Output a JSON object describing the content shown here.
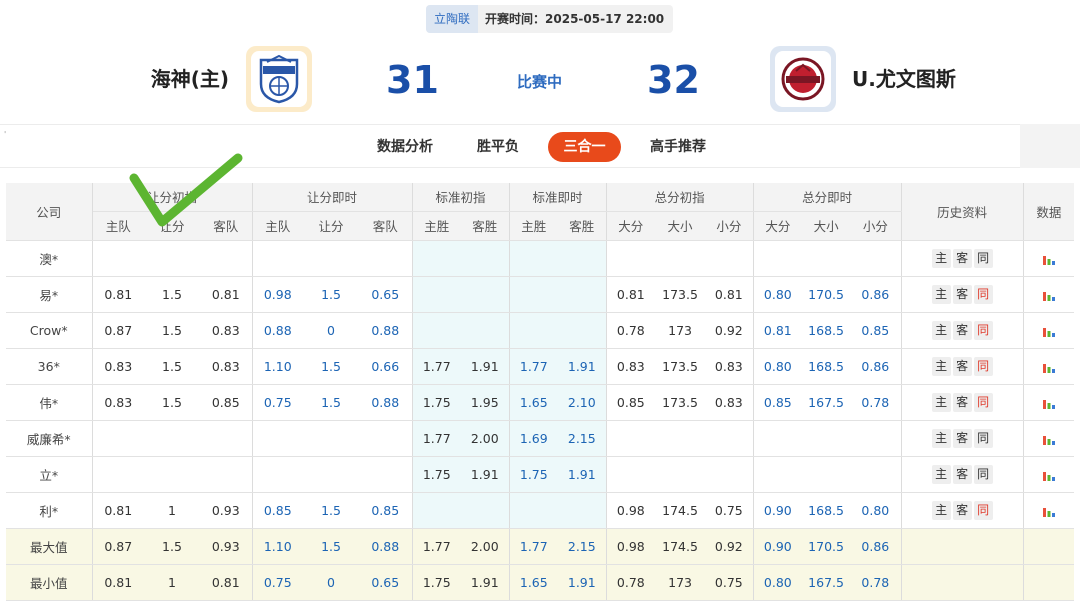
{
  "header": {
    "league": "立陶联",
    "kickoff": "开赛时间：2025-05-17 22:00",
    "home": {
      "name": "海神(主)",
      "score": "31"
    },
    "away": {
      "name": "U.尤文图斯",
      "score": "32"
    },
    "status": "比赛中"
  },
  "tabs": [
    {
      "label": "数据分析",
      "active": false
    },
    {
      "label": "胜平负",
      "active": false
    },
    {
      "label": "三合一",
      "active": true
    },
    {
      "label": "高手推荐",
      "active": false
    }
  ],
  "table": {
    "company_header": "公司",
    "groups": [
      "让分初指",
      "让分即时",
      "标准初指",
      "标准即时",
      "总分初指",
      "总分即时"
    ],
    "history_header": "历史资料",
    "data_header": "数据",
    "sub": {
      "handicap": [
        "主队",
        "让分",
        "客队"
      ],
      "standard": [
        "主胜",
        "客胜"
      ],
      "total": [
        "大分",
        "大小",
        "小分"
      ]
    },
    "history_buttons": [
      "主",
      "客",
      "同"
    ],
    "rows": [
      {
        "company": "澳*",
        "c": [
          "",
          "",
          "",
          "",
          "",
          "",
          "",
          "",
          "",
          "",
          "",
          "",
          "",
          "",
          "",
          "",
          ""
        ],
        "same_red": false
      },
      {
        "company": "易*",
        "c": [
          "0.81",
          "1.5",
          "0.81",
          "0.98",
          "1.5",
          "0.65",
          "",
          "",
          "",
          "",
          "0.81",
          "173.5",
          "0.81",
          "0.80",
          "170.5",
          "0.86"
        ],
        "same_red": true
      },
      {
        "company": "Crow*",
        "c": [
          "0.87",
          "1.5",
          "0.83",
          "0.88",
          "0",
          "0.88",
          "",
          "",
          "",
          "",
          "0.78",
          "173",
          "0.92",
          "0.81",
          "168.5",
          "0.85"
        ],
        "same_red": true
      },
      {
        "company": "36*",
        "c": [
          "0.83",
          "1.5",
          "0.83",
          "1.10",
          "1.5",
          "0.66",
          "1.77",
          "1.91",
          "1.77",
          "1.91",
          "0.83",
          "173.5",
          "0.83",
          "0.80",
          "168.5",
          "0.86"
        ],
        "same_red": true
      },
      {
        "company": "伟*",
        "c": [
          "0.83",
          "1.5",
          "0.85",
          "0.75",
          "1.5",
          "0.88",
          "1.75",
          "1.95",
          "1.65",
          "2.10",
          "0.85",
          "173.5",
          "0.83",
          "0.85",
          "167.5",
          "0.78"
        ],
        "same_red": true
      },
      {
        "company": "威廉希*",
        "c": [
          "",
          "",
          "",
          "",
          "",
          "",
          "1.77",
          "2.00",
          "1.69",
          "2.15",
          "",
          "",
          "",
          "",
          "",
          ""
        ],
        "same_red": false
      },
      {
        "company": "立*",
        "c": [
          "",
          "",
          "",
          "",
          "",
          "",
          "1.75",
          "1.91",
          "1.75",
          "1.91",
          "",
          "",
          "",
          "",
          "",
          ""
        ],
        "same_red": false
      },
      {
        "company": "利*",
        "c": [
          "0.81",
          "1",
          "0.93",
          "0.85",
          "1.5",
          "0.85",
          "",
          "",
          "",
          "",
          "0.98",
          "174.5",
          "0.75",
          "0.90",
          "168.5",
          "0.80"
        ],
        "same_red": true
      }
    ],
    "summary": [
      {
        "label": "最大值",
        "c": [
          "0.87",
          "1.5",
          "0.93",
          "1.10",
          "1.5",
          "0.88",
          "1.77",
          "2.00",
          "1.77",
          "2.15",
          "0.98",
          "174.5",
          "0.92",
          "0.90",
          "170.5",
          "0.86"
        ]
      },
      {
        "label": "最小值",
        "c": [
          "0.81",
          "1",
          "0.81",
          "0.75",
          "0",
          "0.65",
          "1.75",
          "1.91",
          "1.65",
          "1.91",
          "0.78",
          "173",
          "0.75",
          "0.80",
          "167.5",
          "0.78"
        ]
      }
    ]
  },
  "colors": {
    "accent_blue": "#1c64b4",
    "active_tab": "#e84a1b",
    "standard_bg": "#edf9fa",
    "summary_bg": "#f9f8e4",
    "checkmark": "#5cb531",
    "red_text": "#e03b2c"
  },
  "icons": {
    "home_logo": "neptunas-logo",
    "away_logo": "juventus-logo",
    "data_icon": "bar-chart-icon",
    "overlay": "green-checkmark-icon"
  }
}
